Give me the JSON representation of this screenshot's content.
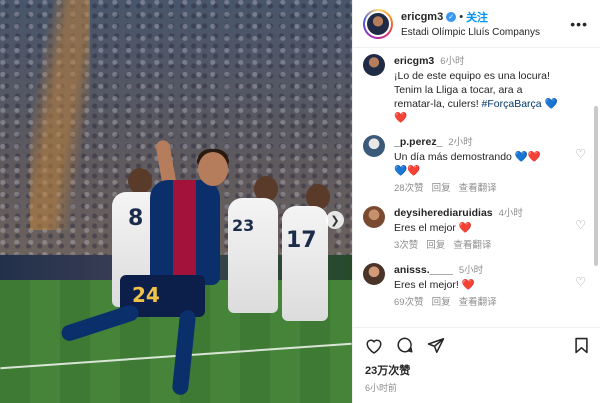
{
  "post": {
    "username": "ericgm3",
    "follow_label": "关注",
    "separator": "•",
    "location": "Estadi Olímpic Lluís Companys",
    "more_icon": "more-horizontal-icon"
  },
  "photo": {
    "jersey_number_main": "24",
    "jersey_number_left": "8",
    "jersey_number_right": "17",
    "jersey_number_mid": "23"
  },
  "caption": {
    "username": "ericgm3",
    "time": "6小时",
    "text": "¡Lo de este equipo es una locura! Tenim la Lliga a tocar, ara a rematar-la, culers! ",
    "hashtag": "#ForçaBarça",
    "emoji": "💙❤️"
  },
  "comments": [
    {
      "username": "_p.perez_",
      "time": "2小时",
      "text": "Un día más demostrando 💙❤️",
      "text2": "💙❤️",
      "likes": "28次赞",
      "reply": "回复",
      "translate": "查看翻译"
    },
    {
      "username": "deysiherediaruidias",
      "time": "4小时",
      "text": "Eres el mejor ❤️",
      "text2": "",
      "likes": "3次赞",
      "reply": "回复",
      "translate": "查看翻译"
    },
    {
      "username": "anisss.____",
      "time": "5小时",
      "text": "Eres el mejor! ❤️",
      "text2": "",
      "likes": "69次赞",
      "reply": "回复",
      "translate": "查看翻译"
    }
  ],
  "footer": {
    "likes": "23万次赞",
    "ago": "6小时前"
  },
  "colors": {
    "accent": "#0095f6",
    "verified": "#3897f0",
    "heart_red": "#ed4956"
  }
}
